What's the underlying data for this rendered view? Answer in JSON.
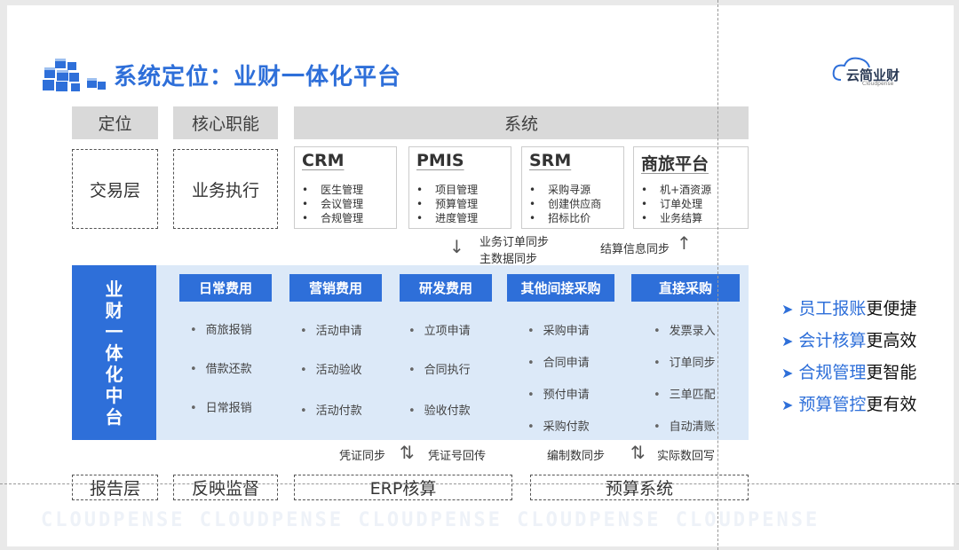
{
  "title": "系统定位：业财一体化平台",
  "brand": {
    "name": "云简业财",
    "sub": "Cloudpense"
  },
  "headers": {
    "position": "定位",
    "core": "核心职能",
    "system": "系统"
  },
  "layer1": {
    "position": "交易层",
    "core": "业务执行"
  },
  "systems": [
    {
      "name": "CRM",
      "items": [
        "医生管理",
        "会议管理",
        "合规管理"
      ]
    },
    {
      "name": "PMIS",
      "items": [
        "项目管理",
        "预算管理",
        "进度管理"
      ]
    },
    {
      "name": "SRM",
      "items": [
        "采购寻源",
        "创建供应商",
        "招标比价"
      ]
    },
    {
      "name": "商旅平台",
      "items": [
        "机+酒资源",
        "订单处理",
        "业务结算"
      ]
    }
  ],
  "sync_top": {
    "left_line1": "业务订单同步",
    "left_line2": "主数据同步",
    "right": "结算信息同步"
  },
  "platform": {
    "label_chars": [
      "业",
      "财",
      "一",
      "体",
      "化",
      "中",
      "台"
    ],
    "columns": [
      {
        "title": "日常费用",
        "items": [
          "商旅报销",
          "借款还款",
          "日常报销"
        ]
      },
      {
        "title": "营销费用",
        "items": [
          "活动申请",
          "活动验收",
          "活动付款"
        ]
      },
      {
        "title": "研发费用",
        "items": [
          "立项申请",
          "合同执行",
          "验收付款"
        ]
      },
      {
        "title": "其他间接采购",
        "items": [
          "采购申请",
          "合同申请",
          "预付申请",
          "采购付款"
        ]
      },
      {
        "title": "直接采购",
        "items": [
          "发票录入",
          "订单同步",
          "三单匹配",
          "自动清账"
        ]
      }
    ]
  },
  "sync_bottom": {
    "a": "凭证同步",
    "b": "凭证号回传",
    "c": "编制数同步",
    "d": "实际数回写"
  },
  "bottom": {
    "position": "报告层",
    "core": "反映监督",
    "erp": "ERP核算",
    "budget": "预算系统"
  },
  "benefits": [
    {
      "hl": "员工报账",
      "rest": "更便捷"
    },
    {
      "hl": "会计核算",
      "rest": "更高效"
    },
    {
      "hl": "合规管理",
      "rest": "更智能"
    },
    {
      "hl": "预算管控",
      "rest": "更有效"
    }
  ],
  "watermark": "CLOUDPENSE  CLOUDPENSE  CLOUDPENSE  CLOUDPENSE  CLOUDPENSE",
  "colors": {
    "accent": "#2e6fd9",
    "band": "#dce9f8",
    "header_bg": "#d9d9d9"
  }
}
